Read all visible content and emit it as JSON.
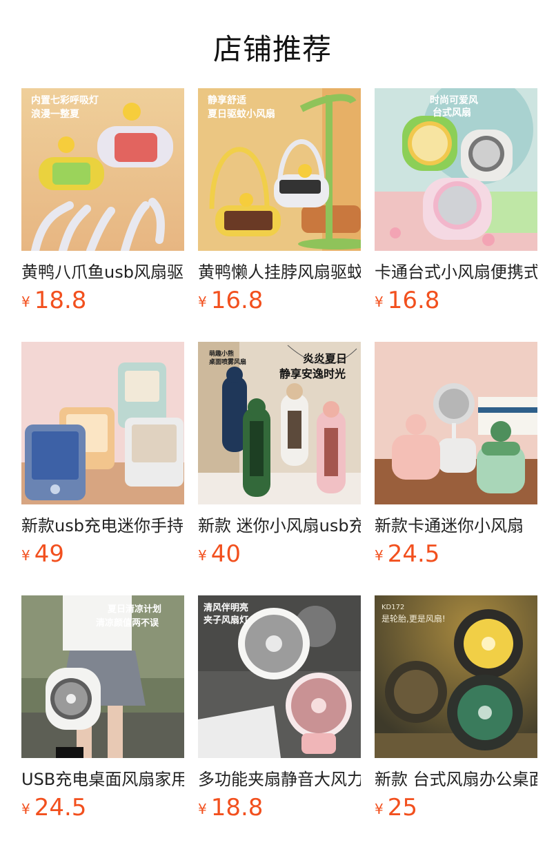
{
  "page": {
    "title": "店铺推荐"
  },
  "products": [
    {
      "name": "黄鸭八爪鱼usb风扇驱蚊",
      "currency": "¥",
      "price": "18.8",
      "image_caption": [
        "内置七彩呼吸灯",
        "浪漫一整夏"
      ],
      "image": "duck-octopus-fan"
    },
    {
      "name": "黄鸭懒人挂脖风扇驱蚊",
      "currency": "¥",
      "price": "16.8",
      "image_caption": [
        "静享舒适",
        "夏日驱蚊小风扇"
      ],
      "image": "duck-neck-fan"
    },
    {
      "name": "卡通台式小风扇便携式",
      "currency": "¥",
      "price": "16.8",
      "image_caption": [
        "时尚可爱风",
        "台式风扇"
      ],
      "image": "cartoon-desk-fan"
    },
    {
      "name": "新款usb充电迷你手持",
      "currency": "¥",
      "price": "49",
      "image_caption": [],
      "image": "mini-cooler-fan"
    },
    {
      "name": "新款 迷你小风扇usb充电",
      "currency": "¥",
      "price": "40",
      "image_caption": [
        "萌趣小熊",
        "桌面喷雾风扇",
        "炎炎夏日",
        "静享安逸时光"
      ],
      "image": "bear-tower-fan"
    },
    {
      "name": "新款卡通迷你小风扇",
      "currency": "¥",
      "price": "24.5",
      "image_caption": [],
      "image": "pig-spray-fan"
    },
    {
      "name": "USB充电桌面风扇家用",
      "currency": "¥",
      "price": "24.5",
      "image_caption": [
        "夏日清凉计划",
        "清凉颜值两不误"
      ],
      "image": "girl-carry-fan"
    },
    {
      "name": "多功能夹扇静音大风力",
      "currency": "¥",
      "price": "18.8",
      "image_caption": [
        "清风伴明亮",
        "夹子风扇灯"
      ],
      "image": "clip-fan-lamp"
    },
    {
      "name": "新款 台式风扇办公桌面",
      "currency": "¥",
      "price": "25",
      "image_caption": [
        "KD172",
        "是轮胎,更是风扇!"
      ],
      "image": "tire-fan"
    }
  ]
}
